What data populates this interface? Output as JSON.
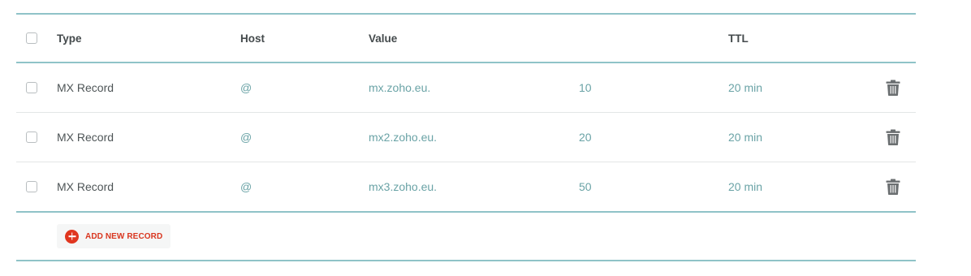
{
  "table": {
    "columns": {
      "type": "Type",
      "host": "Host",
      "value": "Value",
      "priority": "",
      "ttl": "TTL"
    },
    "rows": [
      {
        "type": "MX Record",
        "host": "@",
        "value": "mx.zoho.eu.",
        "priority": "10",
        "ttl": "20 min"
      },
      {
        "type": "MX Record",
        "host": "@",
        "value": "mx2.zoho.eu.",
        "priority": "20",
        "ttl": "20 min"
      },
      {
        "type": "MX Record",
        "host": "@",
        "value": "mx3.zoho.eu.",
        "priority": "50",
        "ttl": "20 min"
      }
    ]
  },
  "actions": {
    "add_new_record_label": "ADD NEW RECORD"
  },
  "icons": {
    "delete": "trash-icon",
    "add": "plus-circle-icon"
  },
  "colors": {
    "rule": "#8fc3c8",
    "link_teal": "#6aa3a6",
    "accent_red": "#e0361f",
    "trash_gray": "#6b6f71"
  }
}
